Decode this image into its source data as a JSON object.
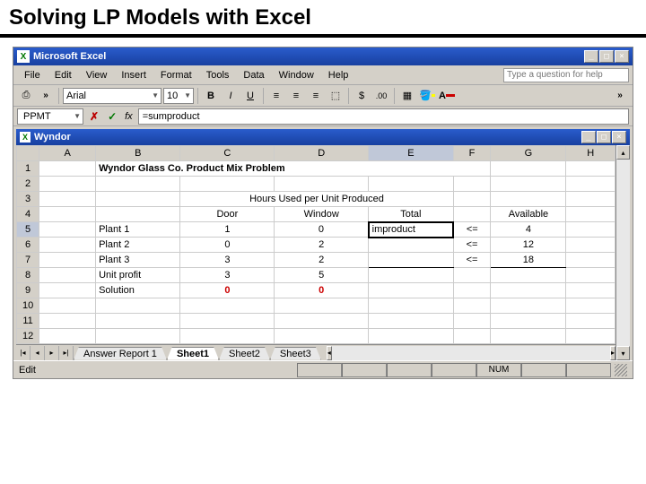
{
  "slide": {
    "title": "Solving LP Models with Excel"
  },
  "app": {
    "title": "Microsoft Excel",
    "help_placeholder": "Type a question for help",
    "menus": [
      "File",
      "Edit",
      "View",
      "Insert",
      "Format",
      "Tools",
      "Data",
      "Window",
      "Help"
    ],
    "font": "Arial",
    "font_size": "10"
  },
  "formula_bar": {
    "name_box": "PPMT",
    "formula": "=sumproduct"
  },
  "doc": {
    "title": "Wyndor"
  },
  "columns": [
    "A",
    "B",
    "C",
    "D",
    "E",
    "F",
    "G",
    "H"
  ],
  "rows": [
    "1",
    "2",
    "3",
    "4",
    "5",
    "6",
    "7",
    "8",
    "9",
    "10",
    "11",
    "12"
  ],
  "cells": {
    "B1": "Wyndor Glass Co. Product Mix Problem",
    "C3": "Hours Used per Unit Produced",
    "C4": "Door",
    "D4": "Window",
    "E4": "Total",
    "G4": "Available",
    "B5": "Plant 1",
    "C5": "1",
    "D5": "0",
    "E5": "improduct",
    "F5": "<=",
    "G5": "4",
    "B6": "Plant 2",
    "C6": "0",
    "D6": "2",
    "F6": "<=",
    "G6": "12",
    "B7": "Plant 3",
    "C7": "3",
    "D7": "2",
    "F7": "<=",
    "G7": "18",
    "B8": "Unit profit",
    "C8": "3",
    "D8": "5",
    "B9": "Solution",
    "C9": "0",
    "D9": "0"
  },
  "tabs": {
    "items": [
      "Answer Report 1",
      "Sheet1",
      "Sheet2",
      "Sheet3"
    ],
    "active": "Sheet1"
  },
  "status": {
    "mode": "Edit",
    "num": "NUM"
  }
}
